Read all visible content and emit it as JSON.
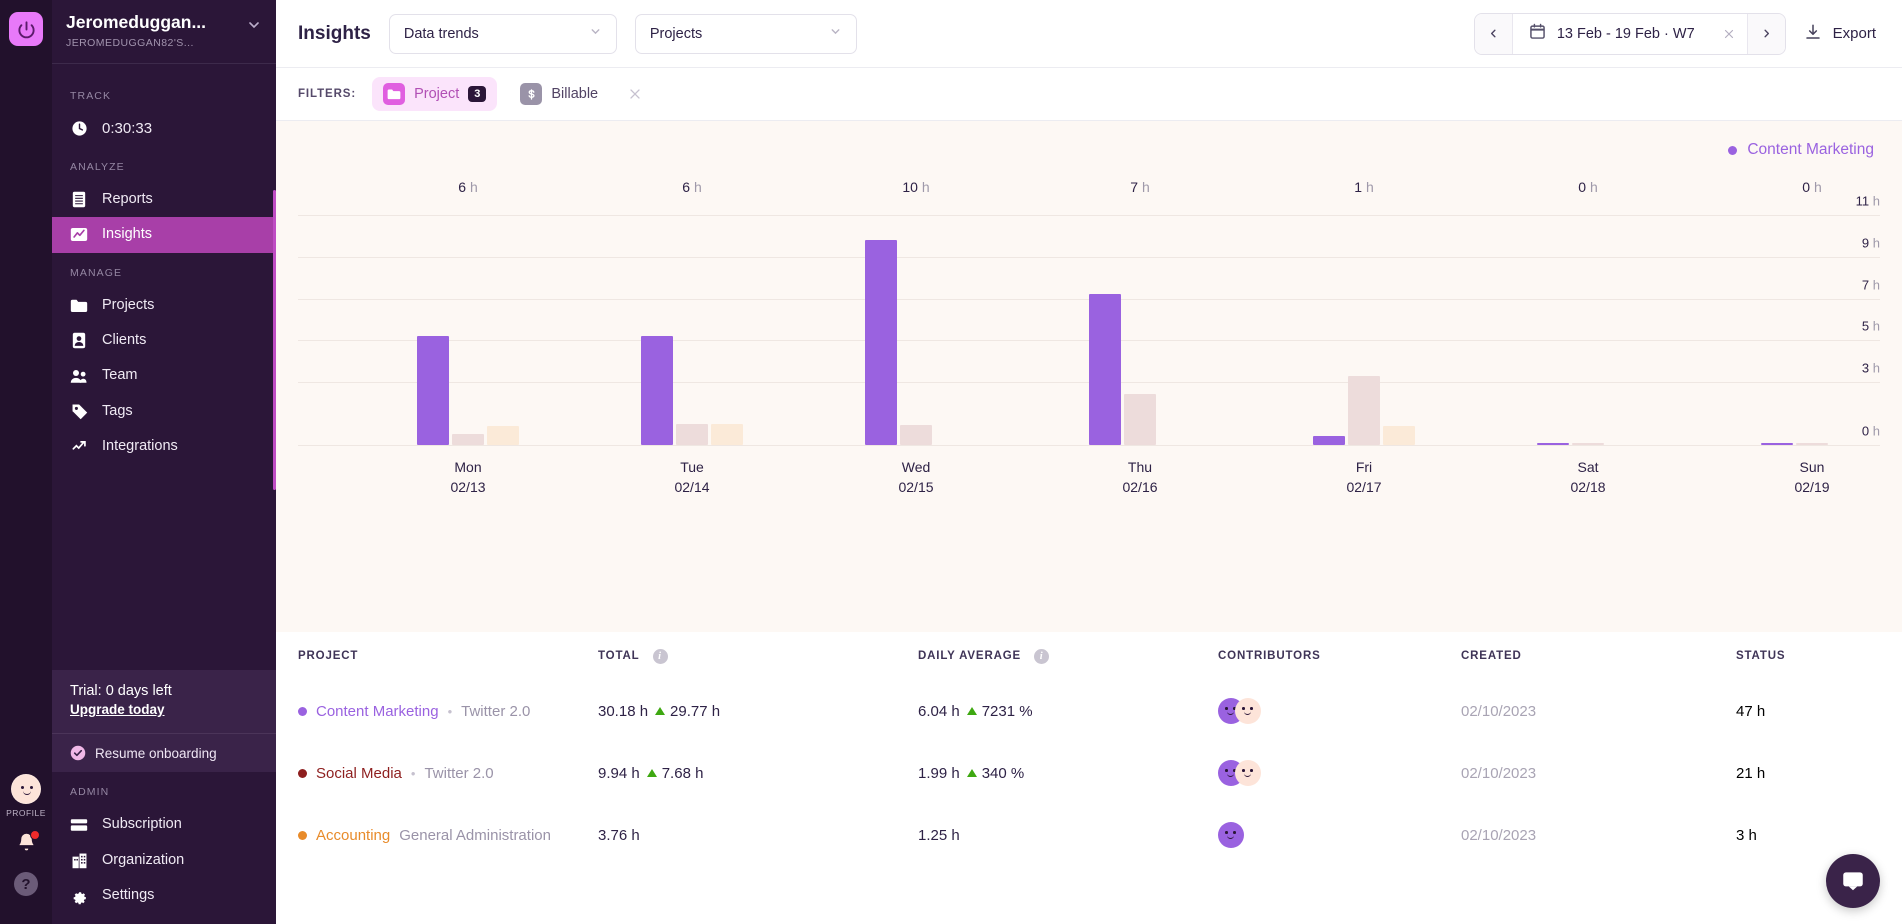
{
  "rail": {
    "logo_icon": "power-logo-icon",
    "profile_label": "PROFILE",
    "notifications_icon": "bell-icon",
    "help_icon": "help-icon"
  },
  "sidebar": {
    "workspace_name": "Jeromeduggan...",
    "workspace_sub": "JEROMEDUGGAN82'S...",
    "sections": [
      {
        "label": "TRACK",
        "items": [
          {
            "label": "0:30:33",
            "icon": "clock-icon",
            "active": false
          }
        ]
      },
      {
        "label": "ANALYZE",
        "items": [
          {
            "label": "Reports",
            "icon": "reports-icon",
            "active": false
          },
          {
            "label": "Insights",
            "icon": "insights-icon",
            "active": true
          }
        ]
      },
      {
        "label": "MANAGE",
        "items": [
          {
            "label": "Projects",
            "icon": "folder-icon",
            "active": false
          },
          {
            "label": "Clients",
            "icon": "client-icon",
            "active": false
          },
          {
            "label": "Team",
            "icon": "team-icon",
            "active": false
          },
          {
            "label": "Tags",
            "icon": "tag-icon",
            "active": false
          },
          {
            "label": "Integrations",
            "icon": "integrations-icon",
            "active": false
          }
        ]
      }
    ],
    "trial": {
      "title": "Trial: 0 days left",
      "upgrade_label": "Upgrade today"
    },
    "onboarding_label": "Resume onboarding",
    "admin": {
      "label": "ADMIN",
      "items": [
        {
          "label": "Subscription",
          "icon": "card-icon"
        },
        {
          "label": "Organization",
          "icon": "building-icon"
        },
        {
          "label": "Settings",
          "icon": "gear-icon"
        }
      ]
    }
  },
  "topbar": {
    "title": "Insights",
    "report_type": "Data trends",
    "group_by": "Projects",
    "date_range": "13 Feb - 19 Feb · W7",
    "prev_label": "‹",
    "next_label": "›",
    "export_label": "Export"
  },
  "filters": {
    "label": "FILTERS:",
    "chips": [
      {
        "label": "Project",
        "icon": "folder-icon",
        "badge": "3",
        "active": true
      },
      {
        "label": "Billable",
        "icon": "dollar-icon",
        "badge": "",
        "active": false
      }
    ],
    "clear_icon": "close-icon"
  },
  "chart_data": {
    "type": "bar",
    "title": "",
    "xlabel": "",
    "ylabel": "",
    "grid": true,
    "legend_position": "top-right",
    "legend": [
      {
        "name": "Content Marketing",
        "color": "#9a62e0"
      }
    ],
    "ylim": [
      0,
      11
    ],
    "yticks": [
      11,
      9,
      7,
      5,
      3,
      0
    ],
    "ytick_labels": [
      "11 h",
      "9 h",
      "7 h",
      "5 h",
      "3 h",
      "0 h"
    ],
    "categories": [
      "Mon",
      "Tue",
      "Wed",
      "Thu",
      "Fri",
      "Sat",
      "Sun"
    ],
    "category_dates": [
      "02/13",
      "02/14",
      "02/15",
      "02/16",
      "02/17",
      "02/18",
      "02/19"
    ],
    "day_totals": [
      "6 h",
      "6 h",
      "10 h",
      "7 h",
      "1 h",
      "0 h",
      "0 h"
    ],
    "series": [
      {
        "name": "Content Marketing",
        "color": "#9a62e0",
        "values": [
          5.2,
          5.2,
          9.8,
          7.2,
          0.45,
          0.1,
          0.1
        ]
      },
      {
        "name": "Social Media",
        "color": "#eddcdb",
        "values": [
          0.55,
          1.0,
          0.95,
          2.45,
          3.3,
          0.07,
          0.06
        ]
      },
      {
        "name": "Accounting",
        "color": "#fbead8",
        "values": [
          0.9,
          1.0,
          0.0,
          0.0,
          0.9,
          0.0,
          0.0
        ]
      }
    ]
  },
  "table": {
    "columns": [
      {
        "key": "project",
        "label": "PROJECT",
        "info": false
      },
      {
        "key": "total",
        "label": "TOTAL",
        "info": true
      },
      {
        "key": "daily",
        "label": "DAILY AVERAGE",
        "info": true
      },
      {
        "key": "contrib",
        "label": "CONTRIBUTORS",
        "info": false
      },
      {
        "key": "created",
        "label": "CREATED",
        "info": false
      },
      {
        "key": "status",
        "label": "STATUS",
        "info": false
      }
    ],
    "rows": [
      {
        "project": "Content Marketing",
        "client": "Twitter 2.0",
        "separator": "•",
        "color": "#9a62e0",
        "total": "30.18 h",
        "total_delta": "29.77 h",
        "daily": "6.04 h",
        "daily_delta": "7231 %",
        "contributors": [
          "purple",
          "peach"
        ],
        "created": "02/10/2023",
        "status": "47 h"
      },
      {
        "project": "Social Media",
        "client": "Twitter 2.0",
        "separator": "•",
        "color": "#8e1f1f",
        "total": "9.94 h",
        "total_delta": "7.68 h",
        "daily": "1.99 h",
        "daily_delta": "340 %",
        "contributors": [
          "purple",
          "peach"
        ],
        "created": "02/10/2023",
        "status": "21 h"
      },
      {
        "project": "Accounting",
        "client": "General Administration",
        "separator": "",
        "color": "#e88b2a",
        "total": "3.76 h",
        "total_delta": "",
        "daily": "1.25 h",
        "daily_delta": "",
        "contributors": [
          "purple"
        ],
        "created": "02/10/2023",
        "status": "3 h"
      }
    ]
  },
  "intercom": {
    "icon": "chat-icon"
  }
}
